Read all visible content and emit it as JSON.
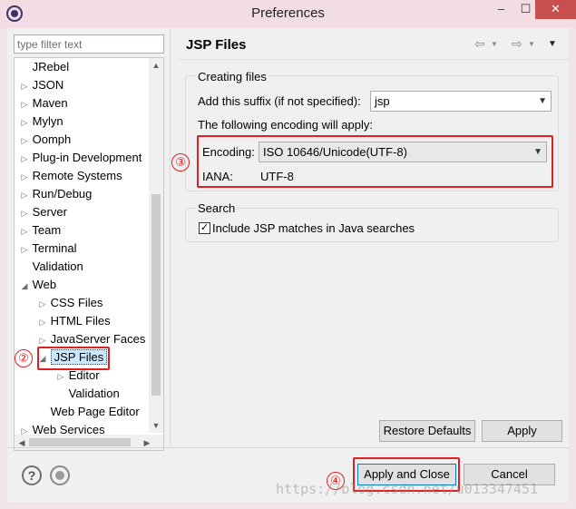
{
  "window": {
    "title": "Preferences",
    "min_glyph": "–",
    "max_glyph": "☐",
    "close_glyph": "✕"
  },
  "sidebar": {
    "filter_placeholder": "type filter text",
    "items": [
      {
        "label": "JRebel",
        "twisty": ""
      },
      {
        "label": "JSON",
        "twisty": "▷"
      },
      {
        "label": "Maven",
        "twisty": "▷"
      },
      {
        "label": "Mylyn",
        "twisty": "▷"
      },
      {
        "label": "Oomph",
        "twisty": "▷"
      },
      {
        "label": "Plug-in Development",
        "twisty": "▷"
      },
      {
        "label": "Remote Systems",
        "twisty": "▷"
      },
      {
        "label": "Run/Debug",
        "twisty": "▷"
      },
      {
        "label": "Server",
        "twisty": "▷"
      },
      {
        "label": "Team",
        "twisty": "▷"
      },
      {
        "label": "Terminal",
        "twisty": "▷"
      },
      {
        "label": "Validation",
        "twisty": ""
      },
      {
        "label": "Web",
        "twisty": "◢"
      },
      {
        "label": "CSS Files",
        "twisty": "▷"
      },
      {
        "label": "HTML Files",
        "twisty": "▷"
      },
      {
        "label": "JavaServer Faces T",
        "twisty": "▷"
      },
      {
        "label": "JSP Files",
        "twisty": "◢"
      },
      {
        "label": "Editor",
        "twisty": "▷"
      },
      {
        "label": "Validation",
        "twisty": ""
      },
      {
        "label": "Web Page Editor",
        "twisty": ""
      },
      {
        "label": "Web Services",
        "twisty": "▷"
      }
    ],
    "scroll_up": "▲",
    "scroll_down": "▼",
    "scroll_left": "◀",
    "scroll_right": "▶"
  },
  "page": {
    "title": "JSP Files",
    "nav": {
      "back": "⇦",
      "dropdown": "▼",
      "forward": "⇨",
      "menu": "▼"
    },
    "creating_files": {
      "group_label": "Creating files",
      "suffix_label": "Add this suffix (if not specified):",
      "suffix_value": "jsp",
      "encoding_note": "The following encoding will apply:",
      "encoding_label": "Encoding:",
      "encoding_value": "ISO 10646/Unicode(UTF-8)",
      "iana_label": "IANA:",
      "iana_value": "UTF-8"
    },
    "search": {
      "group_label": "Search",
      "include_label": "Include JSP matches in Java searches",
      "include_checked": "✓"
    },
    "restore_defaults": "Restore Defaults",
    "apply": "Apply"
  },
  "footer": {
    "help_glyph": "?",
    "apply_and_close": "Apply and Close",
    "cancel": "Cancel"
  },
  "annotations": {
    "n2": "②",
    "n3": "③",
    "n4": "④"
  },
  "watermark": "https://blog.csdn.net/u013347451",
  "colors": {
    "annotation_red": "#e02020",
    "close_button": "#c7504f",
    "selection": "#cce8ff"
  },
  "icons": [
    "app-icon",
    "help-icon",
    "record-icon",
    "back-arrow-icon",
    "forward-arrow-icon",
    "view-menu-icon"
  ]
}
